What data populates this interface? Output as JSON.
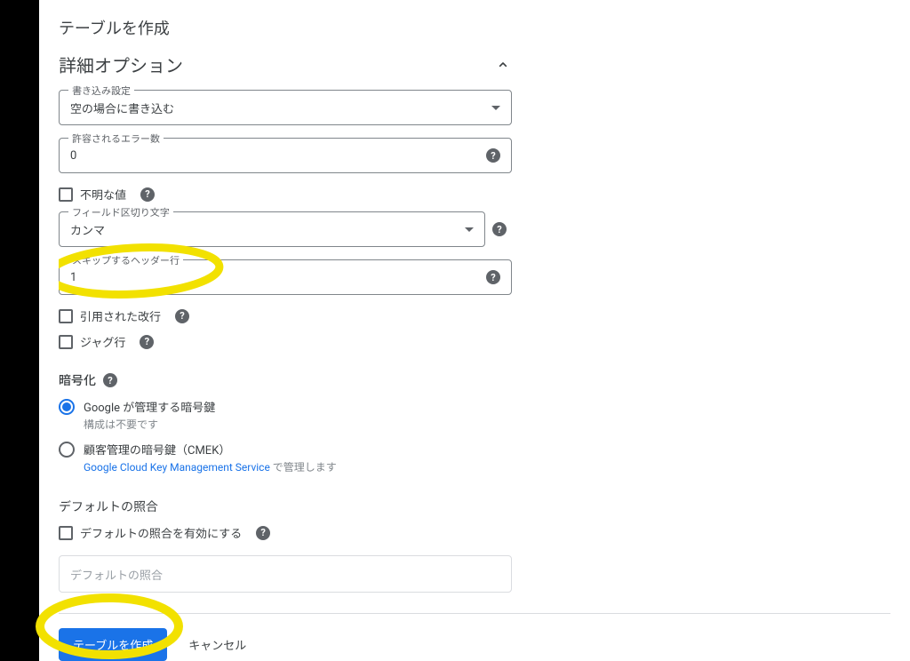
{
  "panel": {
    "title": "テーブルを作成"
  },
  "section": {
    "title": "詳細オプション"
  },
  "write": {
    "label": "書き込み設定",
    "value": "空の場合に書き込む"
  },
  "errors": {
    "label": "許容されるエラー数",
    "value": "0"
  },
  "unknown": {
    "label": "不明な値"
  },
  "delimiter": {
    "label": "フィールド区切り文字",
    "value": "カンマ"
  },
  "skip": {
    "label": "スキップするヘッダー行",
    "value": "1"
  },
  "quoted": {
    "label": "引用された改行"
  },
  "jagged": {
    "label": "ジャグ行"
  },
  "encryption": {
    "heading": "暗号化",
    "google": {
      "label": "Google が管理する暗号鍵",
      "sub": "構成は不要です"
    },
    "cmek": {
      "label": "顧客管理の暗号鍵（CMEK）",
      "link": "Google Cloud Key Management Service",
      "sub_tail": " で管理します"
    }
  },
  "collation": {
    "heading": "デフォルトの照合",
    "enable_label": "デフォルトの照合を有効にする",
    "placeholder": "デフォルトの照合"
  },
  "footer": {
    "create": "テーブルを作成",
    "cancel": "キャンセル"
  }
}
